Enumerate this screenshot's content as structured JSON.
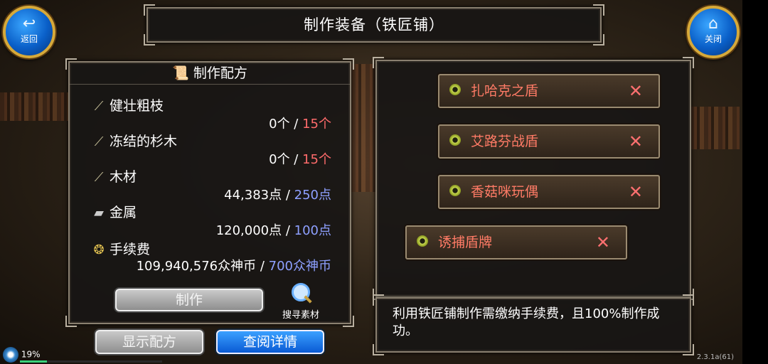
{
  "title": "制作装备（铁匠铺）",
  "nav": {
    "back_label": "返回",
    "close_label": "关闭"
  },
  "recipe": {
    "header": "制作配方",
    "rows": [
      {
        "name": "健壮粗枝",
        "have": "0个",
        "sep": " / ",
        "need": "15个",
        "need_color": "red",
        "icon": "branch-icon"
      },
      {
        "name": "冻结的杉木",
        "have": "0个",
        "sep": " / ",
        "need": "15个",
        "need_color": "red",
        "icon": "branch-icon"
      },
      {
        "name": "木材",
        "have": "44,383点",
        "sep": " / ",
        "need": "250点",
        "need_color": "blue",
        "icon": "branch-icon"
      },
      {
        "name": "金属",
        "have": "120,000点",
        "sep": " / ",
        "need": "100点",
        "need_color": "blue",
        "icon": "metal-ingot-icon"
      },
      {
        "name": "手续费",
        "have": "109,940,576众神币",
        "sep": " / ",
        "need": "700众神币",
        "need_color": "blue",
        "icon": "coins-icon"
      }
    ],
    "make_button": "制作",
    "search_label": "搜寻素材"
  },
  "bottom_buttons": {
    "show_recipe": "显示配方",
    "view_details": "查阅详情"
  },
  "equipment": [
    {
      "name": "扎哈克之盾",
      "remove": "✕"
    },
    {
      "name": "艾路芬战盾",
      "remove": "✕"
    },
    {
      "name": "香菇咪玩偶",
      "remove": "✕"
    },
    {
      "name": "诱捕盾牌",
      "remove": "✕"
    }
  ],
  "description": "利用铁匠铺制作需缴纳手续费，且100%制作成功。",
  "status": {
    "progress_text": "19%",
    "progress": 0.19,
    "version": "2.3.1a(61)"
  },
  "colors": {
    "need_red": "#ff6b6b",
    "need_blue": "#8ea0ff",
    "item_text": "#ff7b66",
    "accent_blue": "#0a5ad4"
  }
}
